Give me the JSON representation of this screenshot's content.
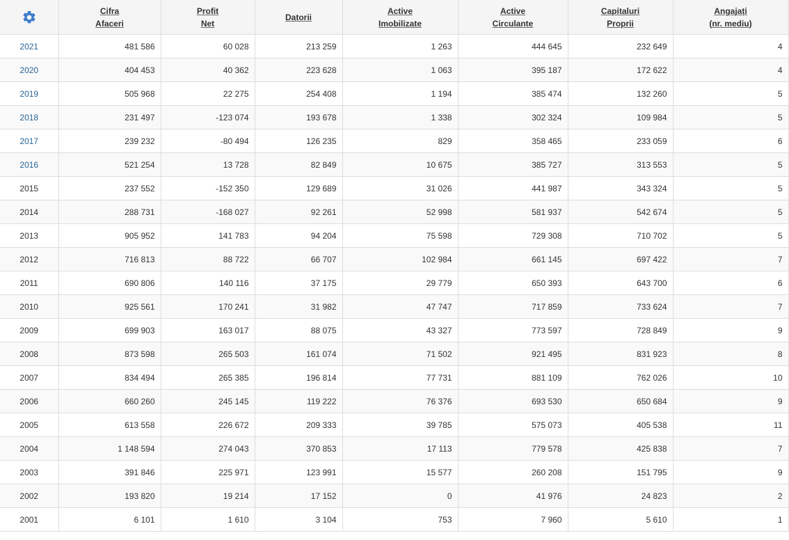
{
  "table": {
    "settings_icon": "gear-icon",
    "accent_color": "#3d7cc9",
    "link_color": "#2a6496",
    "headers": [
      {
        "key": "cifra",
        "line1": "Cifra",
        "line2": "Afaceri"
      },
      {
        "key": "profit",
        "line1": "Profit",
        "line2": "Net"
      },
      {
        "key": "datorii",
        "line1": "Datorii",
        "line2": ""
      },
      {
        "key": "imob",
        "line1": "Active",
        "line2": "Imobilizate"
      },
      {
        "key": "circ",
        "line1": "Active",
        "line2": "Circulante"
      },
      {
        "key": "cap",
        "line1": "Capitaluri",
        "line2": "Proprii"
      },
      {
        "key": "ang",
        "line1": "Angajați",
        "line2": "(nr. mediu)"
      }
    ],
    "rows": [
      {
        "year": "2021",
        "link": true,
        "values": [
          "481 586",
          "60 028",
          "213 259",
          "1 263",
          "444 645",
          "232 649",
          "4"
        ]
      },
      {
        "year": "2020",
        "link": true,
        "values": [
          "404 453",
          "40 362",
          "223 628",
          "1 063",
          "395 187",
          "172 622",
          "4"
        ]
      },
      {
        "year": "2019",
        "link": true,
        "values": [
          "505 968",
          "22 275",
          "254 408",
          "1 194",
          "385 474",
          "132 260",
          "5"
        ]
      },
      {
        "year": "2018",
        "link": true,
        "values": [
          "231 497",
          "-123 074",
          "193 678",
          "1 338",
          "302 324",
          "109 984",
          "5"
        ]
      },
      {
        "year": "2017",
        "link": true,
        "values": [
          "239 232",
          "-80 494",
          "126 235",
          "829",
          "358 465",
          "233 059",
          "6"
        ]
      },
      {
        "year": "2016",
        "link": true,
        "values": [
          "521 254",
          "13 728",
          "82 849",
          "10 675",
          "385 727",
          "313 553",
          "5"
        ]
      },
      {
        "year": "2015",
        "link": false,
        "values": [
          "237 552",
          "-152 350",
          "129 689",
          "31 026",
          "441 987",
          "343 324",
          "5"
        ]
      },
      {
        "year": "2014",
        "link": false,
        "values": [
          "288 731",
          "-168 027",
          "92 261",
          "52 998",
          "581 937",
          "542 674",
          "5"
        ]
      },
      {
        "year": "2013",
        "link": false,
        "values": [
          "905 952",
          "141 783",
          "94 204",
          "75 598",
          "729 308",
          "710 702",
          "5"
        ]
      },
      {
        "year": "2012",
        "link": false,
        "values": [
          "716 813",
          "88 722",
          "66 707",
          "102 984",
          "661 145",
          "697 422",
          "7"
        ]
      },
      {
        "year": "2011",
        "link": false,
        "values": [
          "690 806",
          "140 116",
          "37 175",
          "29 779",
          "650 393",
          "643 700",
          "6"
        ]
      },
      {
        "year": "2010",
        "link": false,
        "values": [
          "925 561",
          "170 241",
          "31 982",
          "47 747",
          "717 859",
          "733 624",
          "7"
        ]
      },
      {
        "year": "2009",
        "link": false,
        "values": [
          "699 903",
          "163 017",
          "88 075",
          "43 327",
          "773 597",
          "728 849",
          "9"
        ]
      },
      {
        "year": "2008",
        "link": false,
        "values": [
          "873 598",
          "265 503",
          "161 074",
          "71 502",
          "921 495",
          "831 923",
          "8"
        ]
      },
      {
        "year": "2007",
        "link": false,
        "values": [
          "834 494",
          "265 385",
          "196 814",
          "77 731",
          "881 109",
          "762 026",
          "10"
        ]
      },
      {
        "year": "2006",
        "link": false,
        "values": [
          "660 260",
          "245 145",
          "119 222",
          "76 376",
          "693 530",
          "650 684",
          "9"
        ]
      },
      {
        "year": "2005",
        "link": false,
        "values": [
          "613 558",
          "226 672",
          "209 333",
          "39 785",
          "575 073",
          "405 538",
          "11"
        ]
      },
      {
        "year": "2004",
        "link": false,
        "values": [
          "1 148 594",
          "274 043",
          "370 853",
          "17 113",
          "779 578",
          "425 838",
          "7"
        ]
      },
      {
        "year": "2003",
        "link": false,
        "values": [
          "391 846",
          "225 971",
          "123 991",
          "15 577",
          "260 208",
          "151 795",
          "9"
        ]
      },
      {
        "year": "2002",
        "link": false,
        "values": [
          "193 820",
          "19 214",
          "17 152",
          "0",
          "41 976",
          "24 823",
          "2"
        ]
      },
      {
        "year": "2001",
        "link": false,
        "values": [
          "6 101",
          "1 610",
          "3 104",
          "753",
          "7 960",
          "5 610",
          "1"
        ]
      }
    ]
  }
}
